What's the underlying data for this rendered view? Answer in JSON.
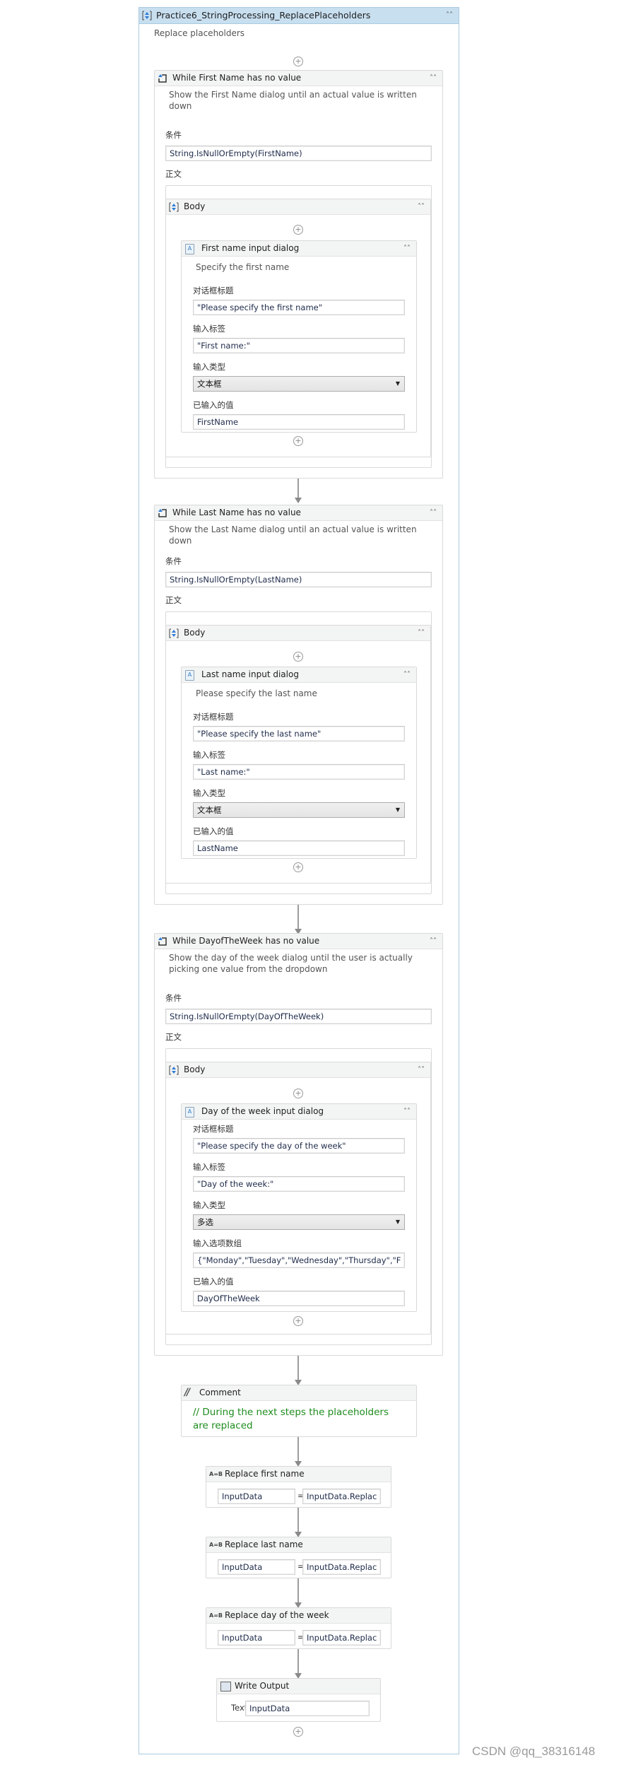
{
  "root": {
    "title": "Practice6_StringProcessing_ReplacePlaceholders",
    "description": "Replace placeholders",
    "icon": "sequence-icon"
  },
  "labels": {
    "condition": "条件",
    "body": "正文",
    "dialog_title": "对话框标题",
    "input_label": "输入标签",
    "input_type": "输入类型",
    "input_options": "输入选项数组",
    "entered_value": "已输入的值",
    "body_sequence": "Body",
    "add": "+",
    "collapse": "≪"
  },
  "while_loops": [
    {
      "title": "While First Name has no value",
      "description": "Show the First Name dialog until an actual value is written down",
      "condition": "String.IsNullOrEmpty(FirstName)",
      "dialog": {
        "title": "First name input dialog",
        "description": "Specify the first name",
        "dialog_title": "\"Please specify the first name\"",
        "input_label": "\"First name:\"",
        "input_type": "文本框",
        "entered_value": "FirstName"
      }
    },
    {
      "title": "While Last Name has no value",
      "description": "Show the Last Name dialog until an actual value is written down",
      "condition": "String.IsNullOrEmpty(LastName)",
      "dialog": {
        "title": "Last name input dialog",
        "description": "Please specify the last name",
        "dialog_title": "\"Please specify the last name\"",
        "input_label": "\"Last name:\"",
        "input_type": "文本框",
        "entered_value": "LastName"
      }
    },
    {
      "title": "While DayofTheWeek has no value",
      "description": "Show the day of the week dialog until the user is actually picking one value from the dropdown",
      "condition": "String.IsNullOrEmpty(DayOfTheWeek)",
      "dialog": {
        "title": "Day of the week input dialog",
        "dialog_title": "\"Please specify the day of the week\"",
        "input_label": "\"Day of the week:\"",
        "input_type": "多选",
        "input_options": "{\"Monday\",\"Tuesday\",\"Wednesday\",\"Thursday\",\"F",
        "entered_value": "DayOfTheWeek"
      }
    }
  ],
  "comment": {
    "title": "Comment",
    "text": "// During the next steps the placeholders are replaced"
  },
  "assigns": [
    {
      "title": "Replace first name",
      "to": "InputData",
      "value": "InputData.Replac"
    },
    {
      "title": "Replace last name",
      "to": "InputData",
      "value": "InputData.Replac"
    },
    {
      "title": "Replace day of the week",
      "to": "InputData",
      "value": "InputData.Replac"
    }
  ],
  "write_output": {
    "title": "Write Output",
    "text_label": "Text",
    "text_value": "InputData"
  },
  "assign_equals": "=",
  "watermark": "CSDN @qq_38316148"
}
